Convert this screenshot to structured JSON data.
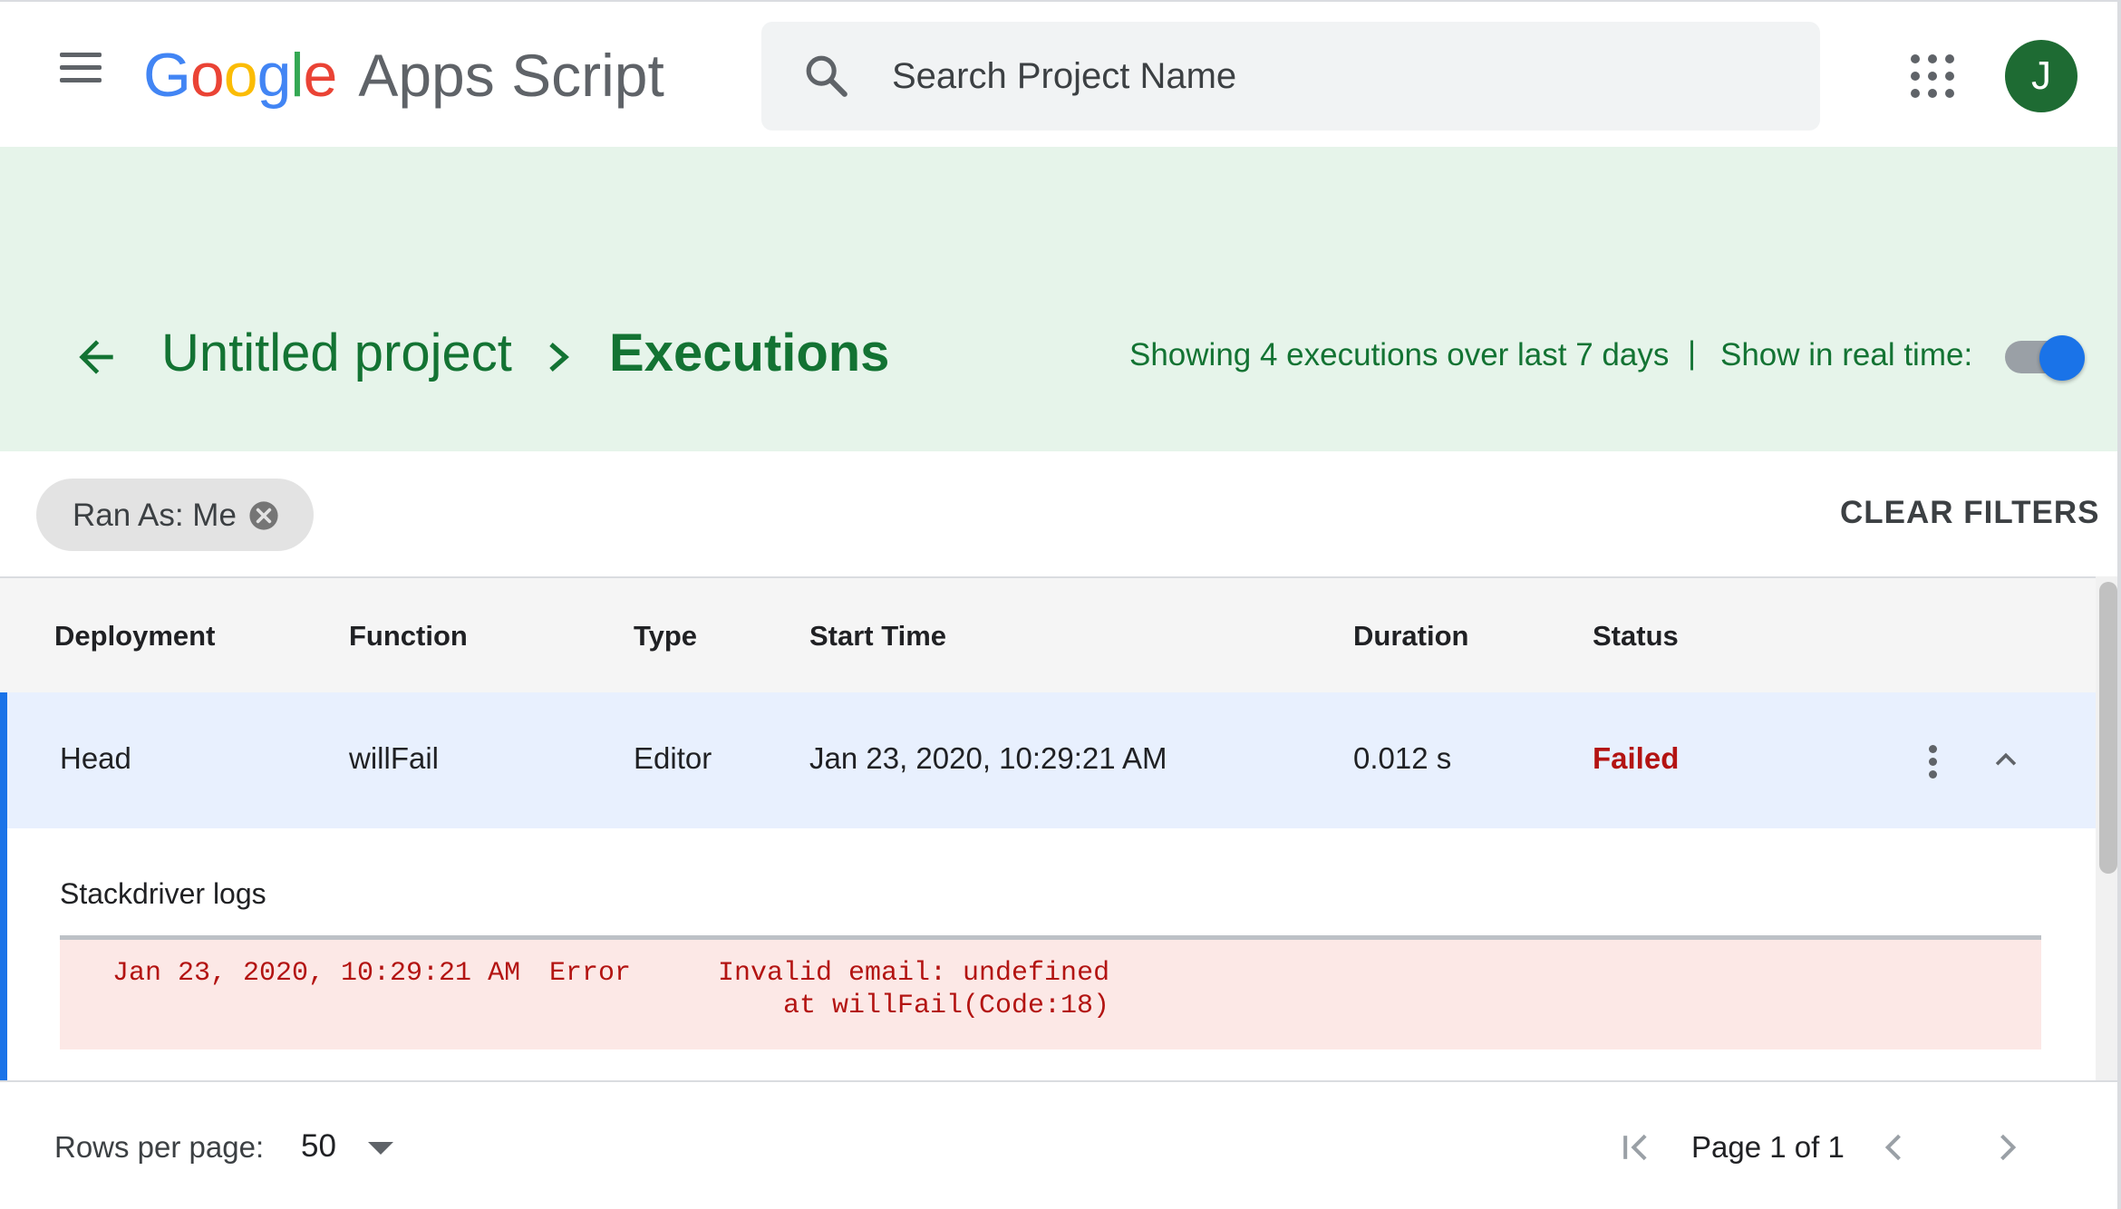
{
  "header": {
    "logo_parts": [
      "G",
      "o",
      "o",
      "g",
      "l",
      "e"
    ],
    "product_name": "Apps Script",
    "search_placeholder": "Search Project Name",
    "avatar_initial": "J"
  },
  "page_header": {
    "project_name": "Untitled project",
    "current_page": "Executions",
    "summary": "Showing 4 executions over last 7 days",
    "separator": "|",
    "realtime_label": "Show in real time:",
    "realtime_enabled": true
  },
  "filters": {
    "chips": [
      {
        "label": "Ran As: Me"
      }
    ],
    "clear_label": "CLEAR FILTERS"
  },
  "table": {
    "columns": [
      "Deployment",
      "Function",
      "Type",
      "Start Time",
      "Duration",
      "Status"
    ],
    "rows": [
      {
        "deployment": "Head",
        "function": "willFail",
        "type": "Editor",
        "start_time": "Jan 23, 2020, 10:29:21 AM",
        "duration": "0.012 s",
        "status": "Failed",
        "expanded": true,
        "logs_title": "Stackdriver logs",
        "logs": [
          {
            "time": "Jan 23, 2020, 10:29:21 AM",
            "level": "Error",
            "message": "Invalid email: undefined",
            "trace": "at willFail(Code:18)"
          }
        ]
      }
    ]
  },
  "pagination": {
    "rows_per_page_label": "Rows per page:",
    "rows_per_page": "50",
    "page_label": "Page 1 of 1"
  },
  "colors": {
    "accent_green": "#137333",
    "band_bg": "#e6f4ea",
    "selected_row_bg": "#e8f0fe",
    "accent_blue": "#1a73e8",
    "error_red": "#b31412",
    "log_bg": "#fce8e6"
  },
  "icons": {
    "menu": "menu-icon",
    "search": "search-icon",
    "apps": "apps-grid-icon",
    "back": "arrow-back-icon",
    "chevron": "chevron-right-icon",
    "chip_close": "cancel-circle-icon",
    "more": "more-vert-icon",
    "collapse": "expand-less-icon",
    "dropdown": "arrow-drop-down-icon",
    "first_page": "first-page-icon",
    "prev_page": "chevron-left-icon",
    "next_page": "chevron-right-icon"
  }
}
